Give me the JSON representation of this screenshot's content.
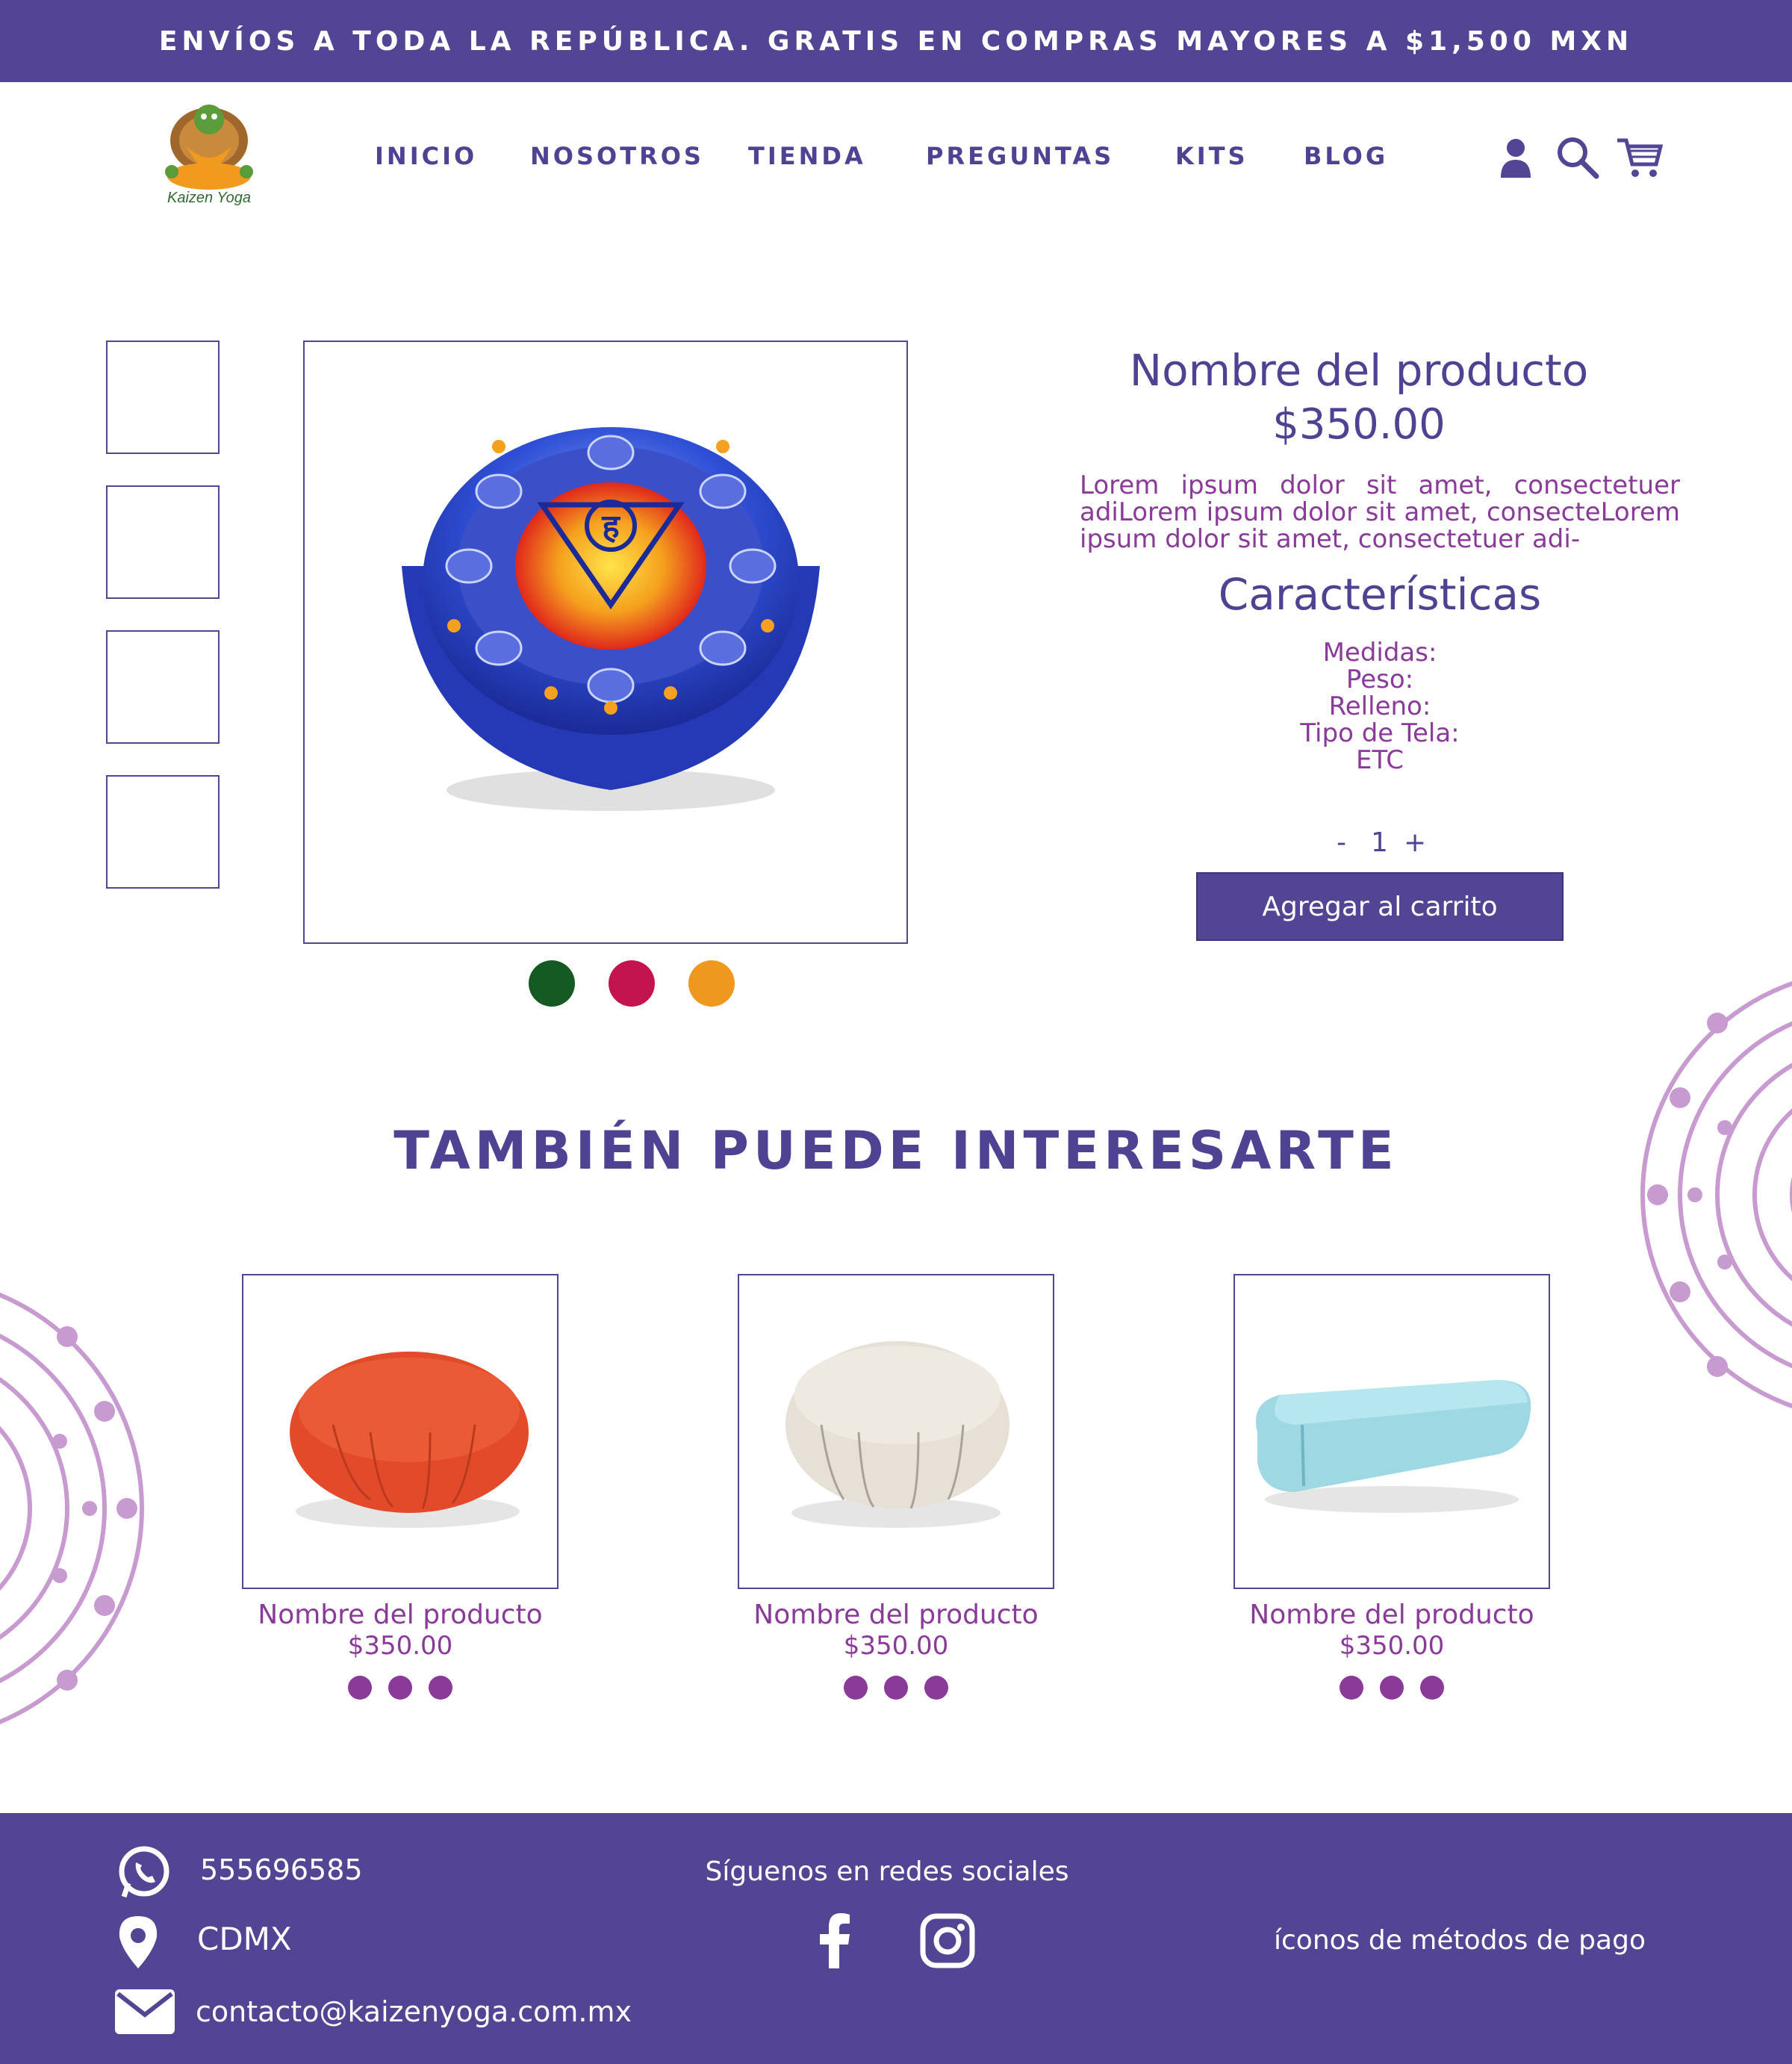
{
  "banner": {
    "text": "ENVÍOS A TODA LA REPÚBLICA. GRATIS EN COMPRAS MAYORES A $1,500 MXN"
  },
  "brand": {
    "logo_text": "Kaizen Yoga"
  },
  "nav": {
    "items": [
      "INICIO",
      "NOSOTROS",
      "TIENDA",
      "PREGUNTAS",
      "KITS",
      "BLOG"
    ]
  },
  "header_icons": [
    "user-icon",
    "search-icon",
    "cart-icon"
  ],
  "product": {
    "title": "Nombre del producto",
    "price": "$350.00",
    "description": "Lorem ipsum dolor sit amet, consectetuer adiLorem ipsum dolor sit amet, consecteLorem ipsum dolor sit amet, consectetuer adi-",
    "features_title": "Características",
    "features": [
      "Medidas:",
      "Peso:",
      "Relleno:",
      "Tipo de Tela:",
      "ETC"
    ],
    "quantity": {
      "minus": "-",
      "value": "1",
      "plus": "+"
    },
    "add_to_cart": "Agregar al carrito",
    "color_options": [
      "#165a23",
      "#c41450",
      "#ef981f"
    ]
  },
  "related": {
    "title": "TAMBIÉN PUEDE INTERESARTE",
    "items": [
      {
        "name": "Nombre del producto",
        "price": "$350.00",
        "image_color": "#e24a2a"
      },
      {
        "name": "Nombre del producto",
        "price": "$350.00",
        "image_color": "#e6e0d6"
      },
      {
        "name": "Nombre del producto",
        "price": "$350.00",
        "image_color": "#9ed9e3"
      }
    ]
  },
  "footer": {
    "phone": "555696585",
    "location": "CDMX",
    "email": "contacto@kaizenyoga.com.mx",
    "social_title": "Síguenos en redes sociales",
    "payment_text": "íconos de métodos de pago"
  },
  "colors": {
    "primary": "#534594",
    "accent": "#8a3a98",
    "mandala": "#c79ad0"
  }
}
